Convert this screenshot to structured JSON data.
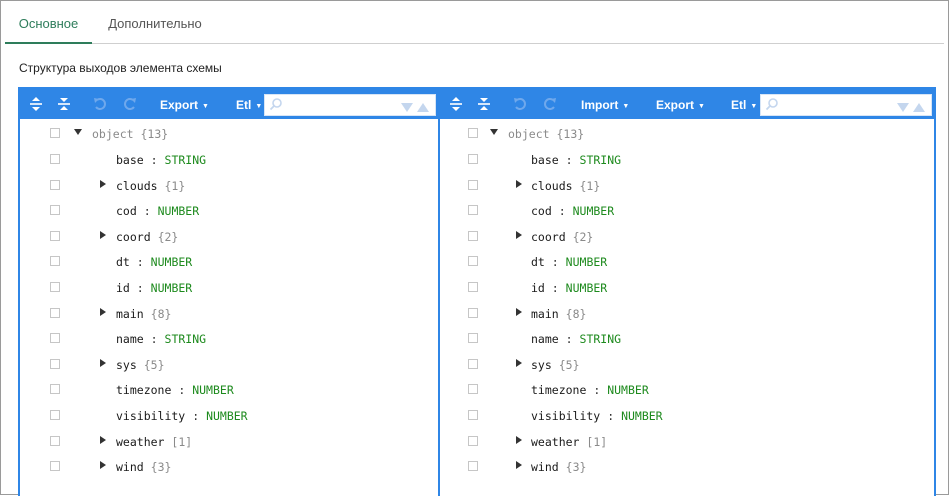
{
  "tabs": [
    {
      "label": "Основное",
      "active": true
    },
    {
      "label": "Дополнительно",
      "active": false
    }
  ],
  "section_title": "Структура выходов элемента схемы",
  "colors": {
    "accent": "#2f86e6",
    "tab_active": "#2e7d5b",
    "type_text": "#1d8a1d"
  },
  "left_panel": {
    "toolbar": {
      "export_label": "Export",
      "etl_label": "Etl",
      "search_placeholder": ""
    },
    "root": {
      "name": "object",
      "count": "{13}"
    },
    "rows": [
      {
        "key": "base",
        "sep": ":",
        "type": "STRING",
        "expandable": false
      },
      {
        "key": "clouds",
        "count": "{1}",
        "expandable": true
      },
      {
        "key": "cod",
        "sep": ":",
        "type": "NUMBER",
        "expandable": false
      },
      {
        "key": "coord",
        "count": "{2}",
        "expandable": true
      },
      {
        "key": "dt",
        "sep": ":",
        "type": "NUMBER",
        "expandable": false
      },
      {
        "key": "id",
        "sep": ":",
        "type": "NUMBER",
        "expandable": false
      },
      {
        "key": "main",
        "count": "{8}",
        "expandable": true
      },
      {
        "key": "name",
        "sep": ":",
        "type": "STRING",
        "expandable": false
      },
      {
        "key": "sys",
        "count": "{5}",
        "expandable": true
      },
      {
        "key": "timezone",
        "sep": ":",
        "type": "NUMBER",
        "expandable": false
      },
      {
        "key": "visibility",
        "sep": ":",
        "type": "NUMBER",
        "expandable": false
      },
      {
        "key": "weather",
        "count": "[1]",
        "expandable": true
      },
      {
        "key": "wind",
        "count": "{3}",
        "expandable": true
      }
    ]
  },
  "right_panel": {
    "toolbar": {
      "import_label": "Import",
      "export_label": "Export",
      "etl_label": "Etl",
      "search_placeholder": ""
    },
    "root": {
      "name": "object",
      "count": "{13}"
    },
    "rows": [
      {
        "key": "base",
        "sep": ":",
        "type": "STRING",
        "expandable": false
      },
      {
        "key": "clouds",
        "count": "{1}",
        "expandable": true
      },
      {
        "key": "cod",
        "sep": ":",
        "type": "NUMBER",
        "expandable": false
      },
      {
        "key": "coord",
        "count": "{2}",
        "expandable": true
      },
      {
        "key": "dt",
        "sep": ":",
        "type": "NUMBER",
        "expandable": false
      },
      {
        "key": "id",
        "sep": ":",
        "type": "NUMBER",
        "expandable": false
      },
      {
        "key": "main",
        "count": "{8}",
        "expandable": true
      },
      {
        "key": "name",
        "sep": ":",
        "type": "STRING",
        "expandable": false
      },
      {
        "key": "sys",
        "count": "{5}",
        "expandable": true
      },
      {
        "key": "timezone",
        "sep": ":",
        "type": "NUMBER",
        "expandable": false
      },
      {
        "key": "visibility",
        "sep": ":",
        "type": "NUMBER",
        "expandable": false
      },
      {
        "key": "weather",
        "count": "[1]",
        "expandable": true
      },
      {
        "key": "wind",
        "count": "{3}",
        "expandable": true
      }
    ]
  },
  "icons": [
    "expand-all-icon",
    "collapse-all-icon",
    "undo-icon",
    "redo-icon",
    "search-icon",
    "next-result-icon",
    "previous-result-icon",
    "caret-down-icon",
    "caret-right-icon",
    "checkbox-icon"
  ]
}
